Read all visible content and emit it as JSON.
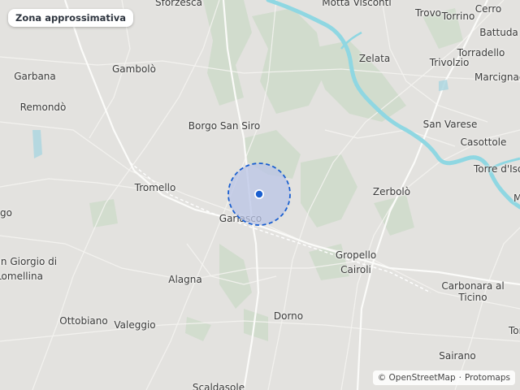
{
  "badge": {
    "label": "Zona approssimativa"
  },
  "attribution": {
    "osm": "© OpenStreetMap",
    "separator": "·",
    "tiles": "Protomaps"
  },
  "marker": {
    "color": "#1a5fd0",
    "area_fill": "#b9c4e6",
    "area_stroke": "#1a5fd0"
  },
  "river_color": "#8fd7e2",
  "places": [
    {
      "id": "sforzesca",
      "label": "Sforzesca"
    },
    {
      "id": "motta-visconti",
      "label": "Motta Visconti"
    },
    {
      "id": "trovo",
      "label": "Trovo"
    },
    {
      "id": "torrino",
      "label": "Torrino"
    },
    {
      "id": "cerro",
      "label": "Cerro"
    },
    {
      "id": "battuda",
      "label": "Battuda"
    },
    {
      "id": "zelata",
      "label": "Zelata"
    },
    {
      "id": "torradello",
      "label": "Torradello"
    },
    {
      "id": "trivolzio",
      "label": "Trivolzio"
    },
    {
      "id": "marcignago",
      "label": "Marcignago"
    },
    {
      "id": "garbana",
      "label": "Garbana"
    },
    {
      "id": "gambolo",
      "label": "Gambolò"
    },
    {
      "id": "remondo",
      "label": "Remondò"
    },
    {
      "id": "borgo-san-siro",
      "label": "Borgo San Siro"
    },
    {
      "id": "san-varese",
      "label": "San Varese"
    },
    {
      "id": "casottole",
      "label": "Casottole"
    },
    {
      "id": "torre-d-isola",
      "label": "Torre d'Isola"
    },
    {
      "id": "tromello",
      "label": "Tromello"
    },
    {
      "id": "zerbolo",
      "label": "Zerbolò"
    },
    {
      "id": "m-edge",
      "label": "M"
    },
    {
      "id": "go-edge",
      "label": "go"
    },
    {
      "id": "garlasco",
      "label": "Garlasco"
    },
    {
      "id": "gropello",
      "label": "Gropello"
    },
    {
      "id": "cairoli",
      "label": "Cairoli"
    },
    {
      "id": "san-giorgio",
      "label": "San Giorgio di"
    },
    {
      "id": "lomellina",
      "label": "Lomellina"
    },
    {
      "id": "alagna",
      "label": "Alagna"
    },
    {
      "id": "carbonara",
      "label": "Carbonara al"
    },
    {
      "id": "ticino",
      "label": "Ticino"
    },
    {
      "id": "ottobiano",
      "label": "Ottobiano"
    },
    {
      "id": "valeggio",
      "label": "Valeggio"
    },
    {
      "id": "dorno",
      "label": "Dorno"
    },
    {
      "id": "tor-edge",
      "label": "Tor"
    },
    {
      "id": "sairano",
      "label": "Sairano"
    },
    {
      "id": "scaldasole",
      "label": "Scaldasole"
    }
  ]
}
